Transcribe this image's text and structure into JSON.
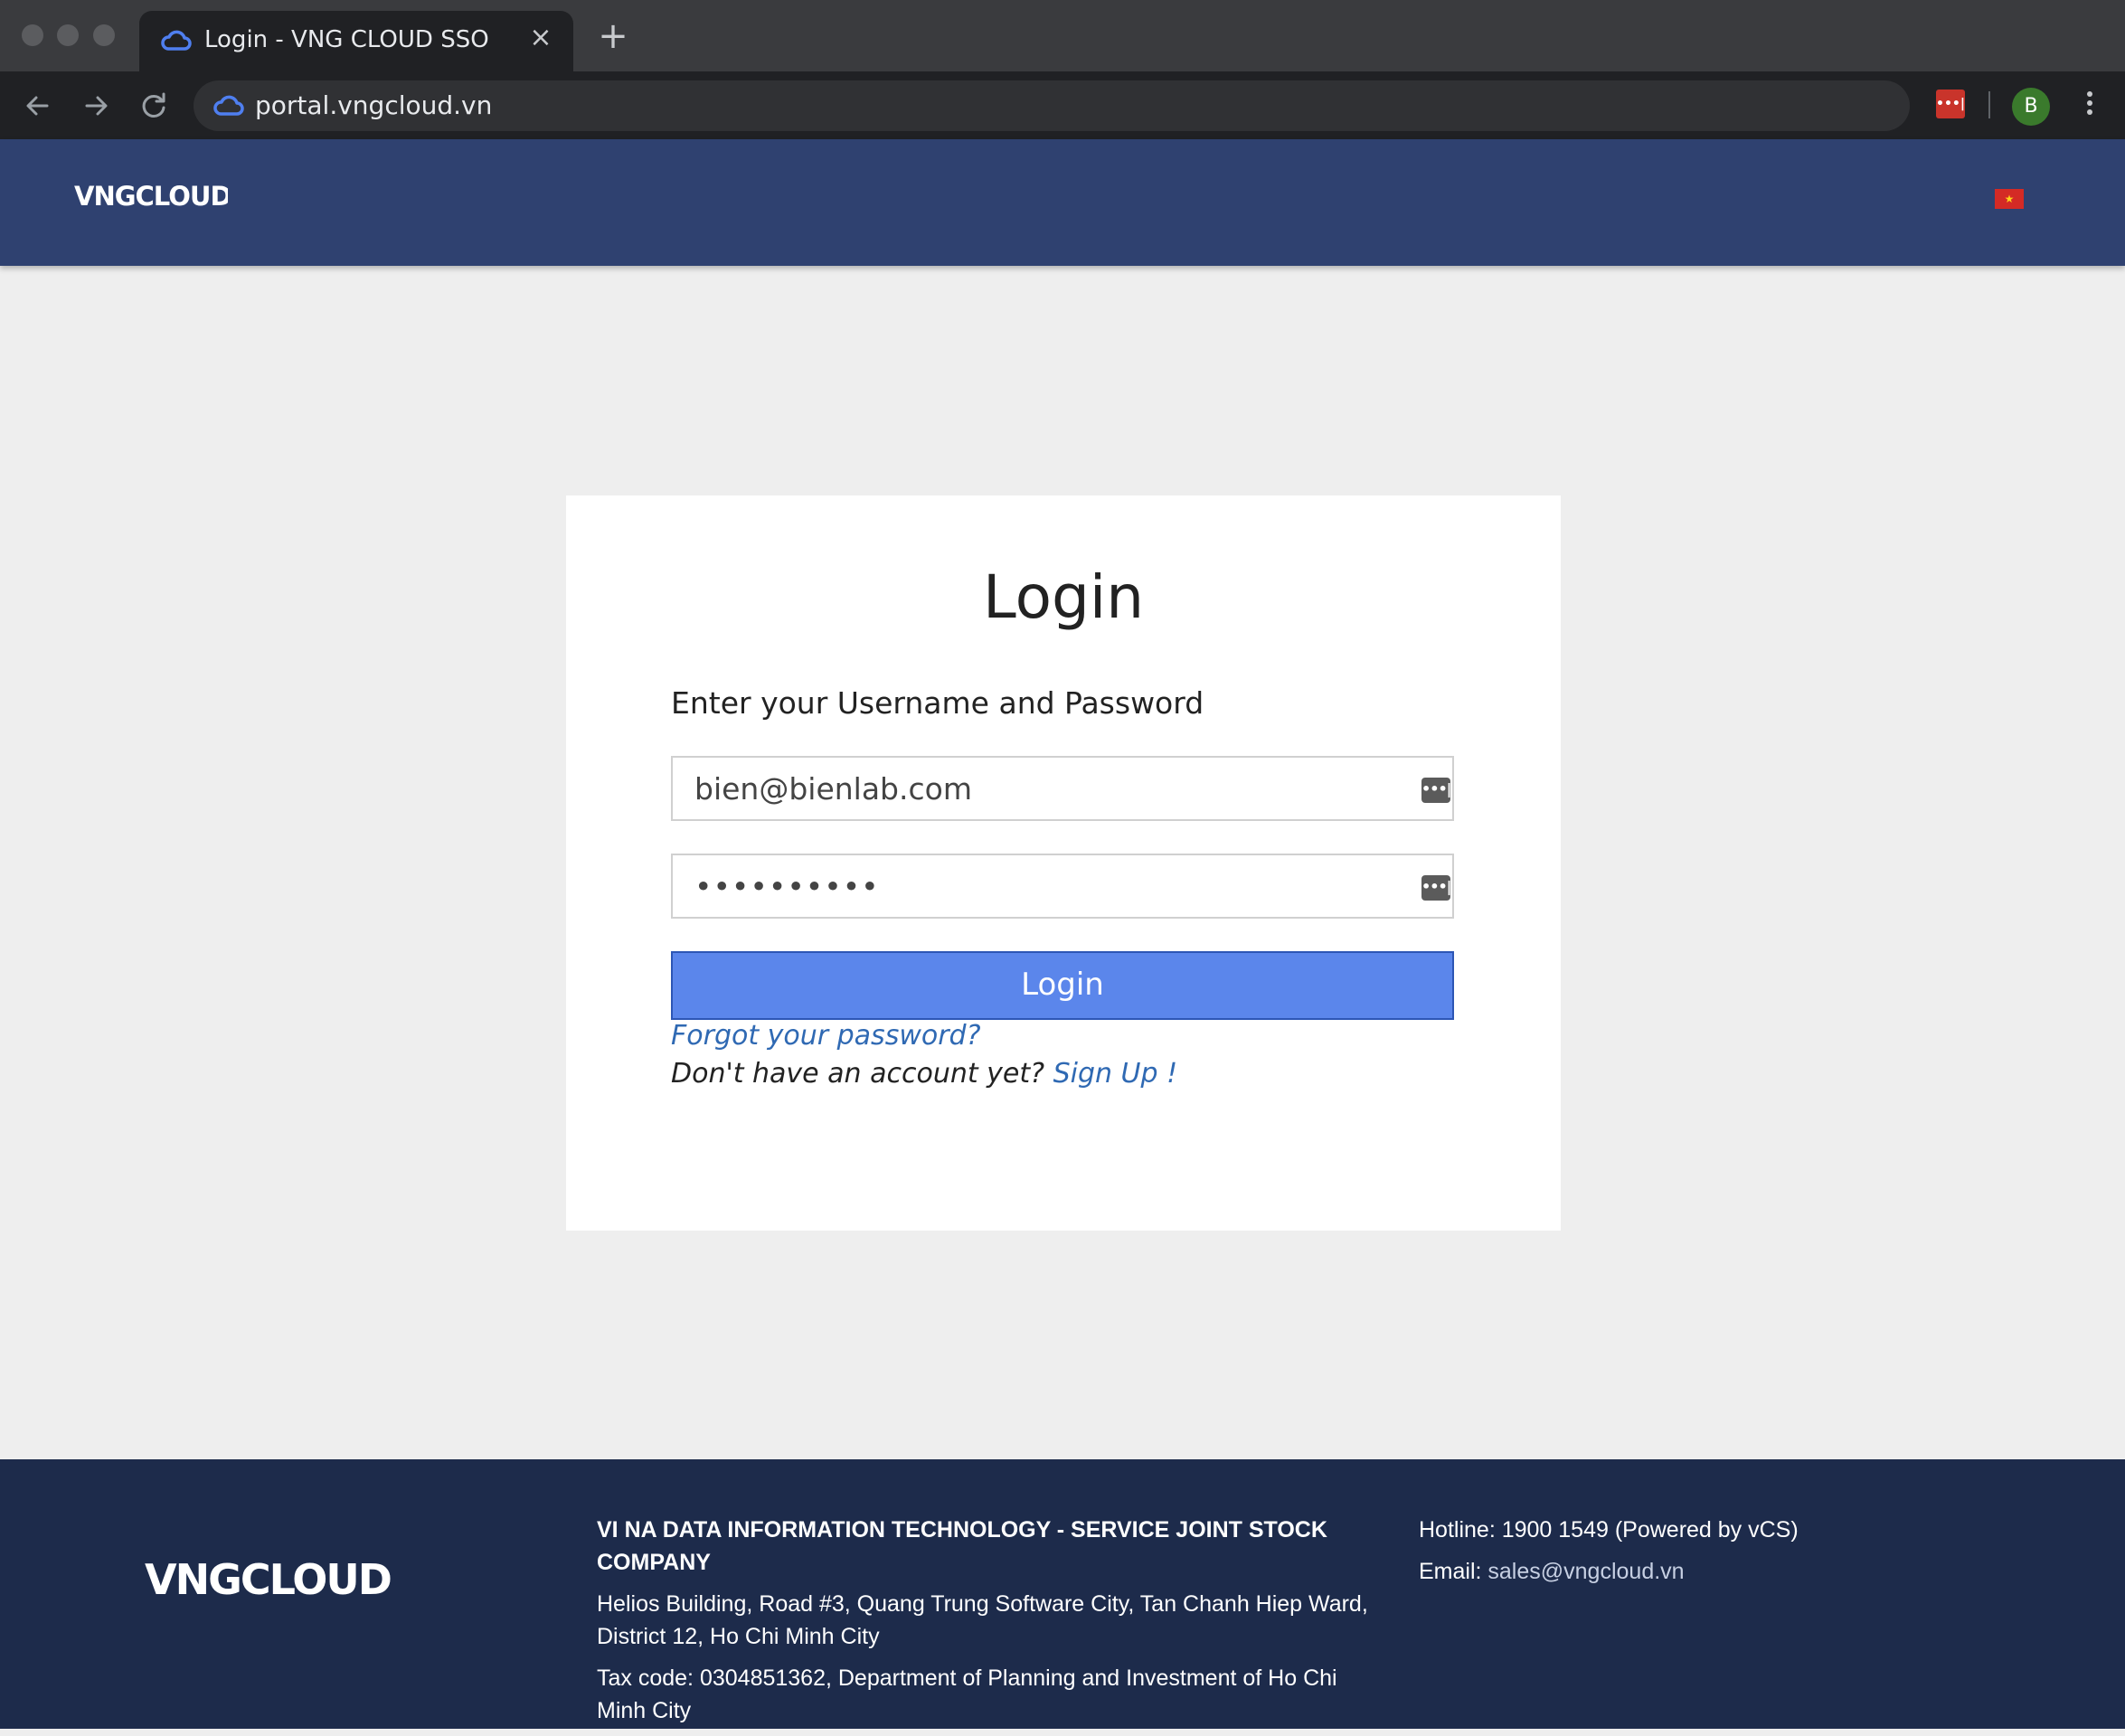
{
  "browser": {
    "tab_title": "Login - VNG CLOUD SSO",
    "tab_close": "×",
    "new_tab": "+",
    "url": "portal.vngcloud.vn",
    "profile_initial": "B",
    "extension_label": "•••|"
  },
  "header": {
    "logo_text": "VNGCLOUD",
    "language_flag": "vietnam-flag"
  },
  "login": {
    "title": "Login",
    "subtitle": "Enter your Username and Password",
    "username_value": "bien@bienlab.com",
    "password_value": "••••••••••",
    "field_icon_label": "•••|",
    "submit_label": "Login",
    "forgot_label": "Forgot your password?",
    "no_account_text": "Don't have an account yet? ",
    "signup_label": "Sign Up !"
  },
  "footer": {
    "logo_text": "VNGCLOUD",
    "company": "VI NA DATA INFORMATION TECHNOLOGY - SERVICE JOINT STOCK COMPANY",
    "address": "Helios Building, Road #3, Quang Trung Software City, Tan Chanh Hiep Ward, District 12, Ho Chi Minh City",
    "tax": "Tax code: 0304851362, Department of Planning and Investment of Ho Chi Minh City",
    "hotline": "Hotline: 1900 1549 (Powered by vCS)",
    "email_label": "Email: ",
    "email_value": "sales@vngcloud.vn"
  },
  "colors": {
    "header_bg": "#2f4170",
    "footer_bg": "#1d2b4b",
    "button_bg": "#5b86eb",
    "link": "#2f69b3"
  }
}
